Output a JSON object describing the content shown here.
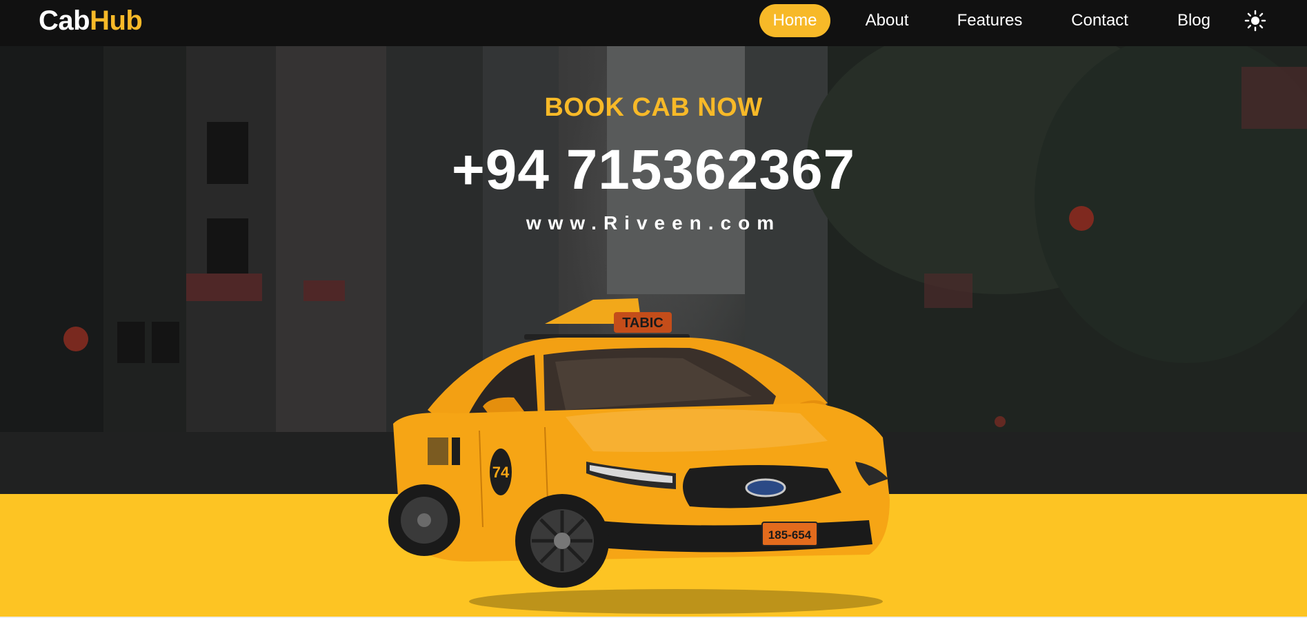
{
  "brand": {
    "part1": "Cab",
    "part2": "Hub",
    "accent_color": "#f7b928"
  },
  "nav": {
    "items": [
      {
        "label": "Home",
        "active": true
      },
      {
        "label": "About",
        "active": false
      },
      {
        "label": "Features",
        "active": false
      },
      {
        "label": "Contact",
        "active": false
      },
      {
        "label": "Blog",
        "active": false
      }
    ],
    "theme_toggle_icon": "sun-icon"
  },
  "hero": {
    "book_label": "BOOK CAB NOW",
    "phone": "+94 715362367",
    "website": "www.Riveen.com",
    "taxi_sign": "TABIC",
    "taxi_door_number": "74",
    "taxi_plate": "185-654"
  },
  "colors": {
    "navbar_bg": "#111111",
    "yellow_band": "#fdc423",
    "taxi_body": "#f6a515"
  }
}
